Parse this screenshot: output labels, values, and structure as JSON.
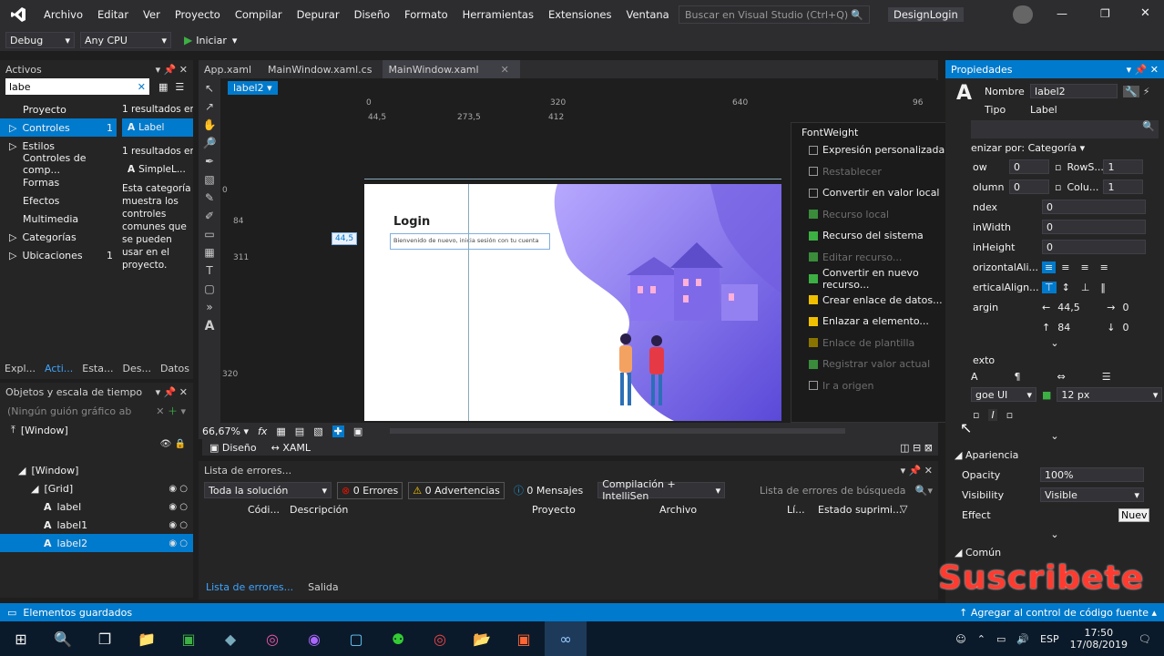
{
  "menu": {
    "items": [
      "Archivo",
      "Editar",
      "Ver",
      "Proyecto",
      "Compilar",
      "Depurar",
      "Diseño",
      "Formato",
      "Herramientas",
      "Extensiones",
      "Ventana",
      "Ayuda"
    ],
    "search_placeholder": "Buscar en Visual Studio (Ctrl+Q)",
    "app_title": "DesignLogin"
  },
  "toolbar": {
    "config": "Debug",
    "platform": "Any CPU",
    "start_label": "Iniciar"
  },
  "assets": {
    "title": "Activos",
    "search_value": "labe",
    "categories": [
      {
        "label": "Proyecto",
        "count": ""
      },
      {
        "label": "Controles",
        "count": "1"
      },
      {
        "label": "Estilos",
        "count": ""
      },
      {
        "label": "Controles de comp...",
        "count": ""
      },
      {
        "label": "Formas",
        "count": ""
      },
      {
        "label": "Efectos",
        "count": ""
      },
      {
        "label": "Multimedia",
        "count": ""
      },
      {
        "label": "Categorías",
        "count": ""
      },
      {
        "label": "Ubicaciones",
        "count": "1"
      }
    ],
    "results1": "1 resultados en",
    "result_label": "Label",
    "results2": "1 resultados en",
    "result_simple": "SimpleL...",
    "description": "Esta categoría muestra los controles comunes que se pueden usar en el proyecto.",
    "bottom_tabs": [
      "Expl...",
      "Acti...",
      "Esta...",
      "Des...",
      "Datos"
    ]
  },
  "objects": {
    "title": "Objetos y escala de tiempo",
    "storyboard": "(Ningún guión gráfico ab",
    "window_top": "[Window]",
    "tree": [
      {
        "label": "[Window]",
        "indent": 1
      },
      {
        "label": "[Grid]",
        "indent": 2
      },
      {
        "label": "label",
        "indent": 3
      },
      {
        "label": "label1",
        "indent": 3
      },
      {
        "label": "label2",
        "indent": 3
      }
    ]
  },
  "doc_tabs": [
    "App.xaml",
    "MainWindow.xaml.cs",
    "MainWindow.xaml"
  ],
  "designer": {
    "selected": "label2",
    "ruler_marks": [
      "0",
      "320",
      "640",
      "96"
    ],
    "ruler_sub": [
      "44,5",
      "273,5",
      "412"
    ],
    "vruler": [
      "0",
      "84",
      "311",
      "320"
    ],
    "login_title": "Login",
    "login_sub": "Bienvenido de nuevo, inicia sesión con tu cuenta",
    "margin_badge": "44,5",
    "zoom": "66,67%",
    "view_tabs": [
      "Diseño",
      "XAML"
    ]
  },
  "context_menu": {
    "header": "FontWeight",
    "items": [
      {
        "label": "Expresión personalizada...",
        "dim": false,
        "color": "#none"
      },
      {
        "label": "Restablecer",
        "dim": true,
        "color": "#none"
      },
      {
        "label": "Convertir en valor local",
        "dim": false,
        "color": "#none"
      },
      {
        "label": "Recurso local",
        "dim": true,
        "color": "#3a8c3a"
      },
      {
        "label": "Recurso del sistema",
        "dim": false,
        "color": "#3cb043"
      },
      {
        "label": "Editar recurso...",
        "dim": true,
        "color": "#3a8c3a"
      },
      {
        "label": "Convertir en nuevo recurso...",
        "dim": false,
        "color": "#3cb043"
      },
      {
        "label": "Crear enlace de datos...",
        "dim": false,
        "color": "#f0c000"
      },
      {
        "label": "Enlazar a elemento...",
        "dim": false,
        "color": "#f0c000"
      },
      {
        "label": "Enlace de plantilla",
        "dim": true,
        "color": "#8a7400"
      },
      {
        "label": "Registrar valor actual",
        "dim": true,
        "color": "#3a8c3a"
      },
      {
        "label": "Ir a origen",
        "dim": true,
        "color": "#none"
      }
    ]
  },
  "properties": {
    "title": "Propiedades",
    "name_label": "Nombre",
    "name_value": "label2",
    "type_label": "Tipo",
    "type_value": "Label",
    "arrange": "enizar por: Categoría",
    "rows": [
      {
        "l": "ow",
        "v": "0",
        "l2": "RowS...",
        "v2": "1"
      },
      {
        "l": "olumn",
        "v": "0",
        "l2": "Colu...",
        "v2": "1"
      },
      {
        "l": "ndex",
        "v": "0"
      },
      {
        "l": "inWidth",
        "v": "0"
      },
      {
        "l": "inHeight",
        "v": "0"
      }
    ],
    "halign": "orizontalAli...",
    "valign": "erticalAlign...",
    "margin": "argin",
    "margin_left": "44,5",
    "margin_right": "0",
    "margin_top": "84",
    "margin_bottom": "0",
    "text_section": "exto",
    "font": "goe UI",
    "font_size": "12 px",
    "appearance": "Apariencia",
    "opacity_label": "Opacity",
    "opacity": "100%",
    "visibility_label": "Visibility",
    "visibility": "Visible",
    "effect_label": "Effect",
    "effect_btn": "Nuev",
    "common": "Común"
  },
  "errors": {
    "title": "Lista de errores...",
    "scope": "Toda la solución",
    "errors": "0 Errores",
    "warnings": "0 Advertencias",
    "messages": "0 Mensajes",
    "build": "Compilación + IntelliSen",
    "search": "Lista de errores de búsqueda",
    "columns": [
      "Códi...",
      "Descripción",
      "Proyecto",
      "Archivo",
      "Lí...",
      "Estado suprimi..."
    ],
    "bottom_tabs": [
      "Lista de errores...",
      "Salida"
    ]
  },
  "status": {
    "left": "Elementos guardados",
    "right": "Agregar al control de código fuente"
  },
  "taskbar": {
    "lang": "ESP",
    "time": "17:50",
    "date": "17/08/2019"
  },
  "overlay": "Suscribete"
}
